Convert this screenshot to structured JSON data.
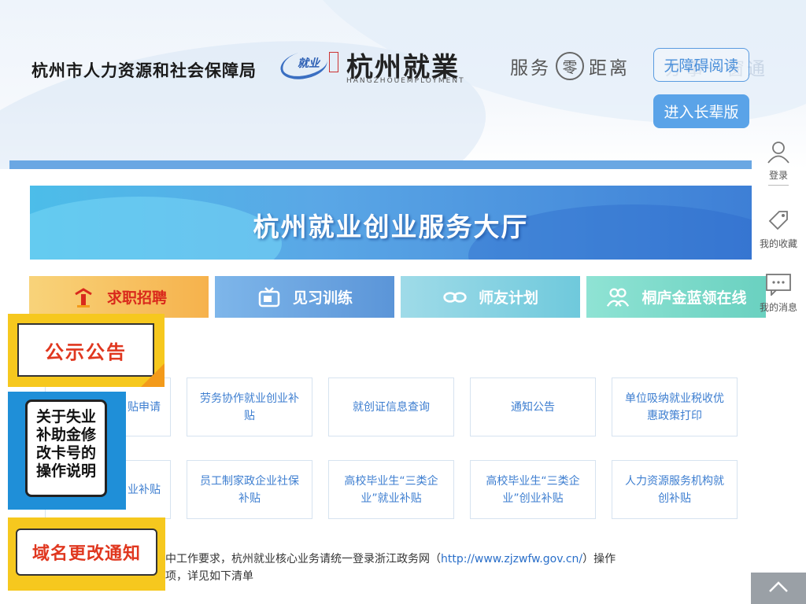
{
  "header": {
    "bureau_title": "杭州市人力资源和社会保障局",
    "logo": {
      "mini": "就业",
      "main": "杭州就業",
      "sub": "HANGZHOUEMPLOYMENT"
    },
    "slogan": {
      "left": "服务",
      "zero": "零",
      "right": "距离"
    },
    "slogan_faded": "办事一窗通",
    "ghost_button": "无障碍阅读",
    "elder_button": "进入长辈版"
  },
  "hero": {
    "title": "杭州就业创业服务大厅"
  },
  "categories": [
    {
      "label": "求职招聘",
      "icon": "job-icon"
    },
    {
      "label": "见习训练",
      "icon": "tv-icon"
    },
    {
      "label": "师友计划",
      "icon": "infinity-icon"
    },
    {
      "label": "桐庐金蓝领在线",
      "icon": "people-icon"
    }
  ],
  "services": [
    {
      "label": "贴申请"
    },
    {
      "label": "劳务协作就业创业补贴"
    },
    {
      "label": "就创证信息查询"
    },
    {
      "label": "通知公告"
    },
    {
      "label": "单位吸纳就业税收优惠政策打印"
    },
    {
      "label": "业补贴"
    },
    {
      "label": "员工制家政企业社保补贴"
    },
    {
      "label": "高校毕业生“三类企业”就业补贴"
    },
    {
      "label": "高校毕业生“三类企业”创业补贴"
    },
    {
      "label": "人力资源服务机构就创补贴"
    }
  ],
  "notice": {
    "line1_before": "集中工作要求，杭州就业核心业务请统一登录浙江政务网（",
    "link": "http://www.zjzwfw.gov.cn/",
    "line1_after": "）操作",
    "line2": "事项，详见如下清单"
  },
  "badges": {
    "announcement": "公示公告",
    "unemployment": "关于失业补助金修改卡号的操作说明",
    "domain_change": "域名更改通知"
  },
  "sidebar": {
    "login": "登录",
    "favorites": "我的收藏",
    "messages": "我的消息"
  },
  "colors": {
    "accent": "#5aa3e8",
    "link": "#3d7ed0",
    "badge_yellow": "#f6c81e",
    "badge_red": "#e0371f"
  }
}
